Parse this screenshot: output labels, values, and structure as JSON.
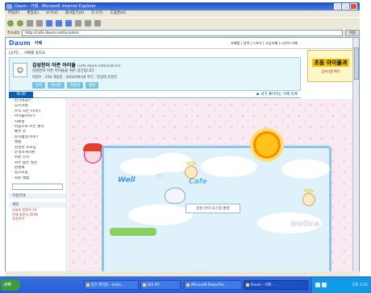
{
  "window": {
    "title": "Daum - 카페 - Microsoft Internet Explorer"
  },
  "menubar": {
    "items": [
      "파일(F)",
      "편집(E)",
      "보기(V)",
      "즐겨찾기(A)",
      "도구(T)",
      "도움말(H)"
    ]
  },
  "address": {
    "label": "주소(D)",
    "url": "http://cafe.daum.net/localism",
    "go_label": "이동"
  },
  "cafe_header": {
    "logo": "Daum",
    "section": "카페",
    "links": "카페홈 | 검색 | 스포츠 | 고급카페 | 나만의 카페",
    "notice": "[공지] ... 카페를 찾아요"
  },
  "cafe_info": {
    "title": "감성찬이 아픈 아이들",
    "url": "(cafe.daum.net/localism)",
    "subtitle": "감성찬이 아픈 아이들을 위한 공간입니다.",
    "stats": "회원수 : 256  개설일 : 2002/09/18  주인 : 현상태  운영진",
    "tabs": [
      "공지",
      "게시판",
      "자료실",
      "앨범"
    ]
  },
  "menu_line": {
    "current": "게시판",
    "right": "▶ 내가 좋아하는 카페 등록"
  },
  "banner": {
    "line1": "초등 아이들과",
    "line2": "공지사항 확인"
  },
  "sidebar": {
    "items": [
      "반가워요!!",
      "공지사항",
      "우리 사는 이야기",
      "아이들이야기",
      "자료실",
      "마음으로 쓰는 편지",
      "좋은 글",
      "봉사활동이야기",
      "앨범",
      "감성찬 소모임",
      "운영자게시판",
      "회원 인사",
      "자주 묻는 질문",
      "방명록",
      "링크모음",
      "회원 앨범"
    ],
    "section1": "이용안내",
    "section2": "새글",
    "tiny": [
      "오늘의 방문자 12",
      "전체 방문자 3546",
      "추천하기"
    ]
  },
  "main": {
    "logo_left": "Well",
    "logo_right": "Cafe",
    "heart": "♡",
    "welcome": "감성 아이 오신걸 환영",
    "notice_word": "Notice"
  },
  "taskbar": {
    "start_label": "시작",
    "tasks": [
      "받은 편지함 - Outlo...",
      "DIS PIF",
      "Microsoft PowerPoi...",
      "Daum - 카페 - ..."
    ],
    "active_index": 3,
    "time": "오후 1:25"
  },
  "colors": {
    "title_blue": "#245edb",
    "cafe_blue": "#0a60b0",
    "accent_sky": "#8fc4e8",
    "sun": "#ffc21a"
  }
}
